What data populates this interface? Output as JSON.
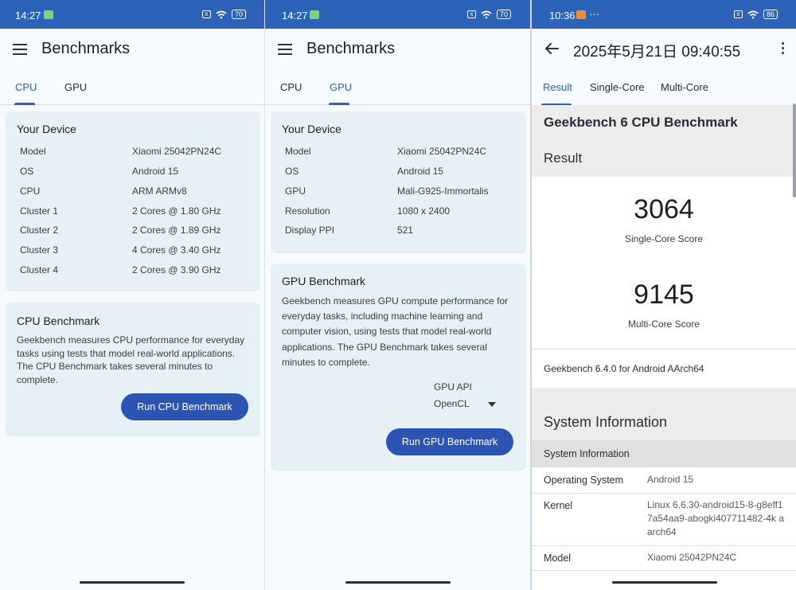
{
  "status": {
    "left_time": "14:27",
    "right_time": "10:36",
    "battery_left": "70",
    "battery_right": "86",
    "dots": "···",
    "x_box": "x"
  },
  "phone1": {
    "title": "Benchmarks",
    "tabs": [
      "CPU",
      "GPU"
    ],
    "device_card": {
      "title": "Your Device",
      "rows": [
        {
          "label": "Model",
          "value": "Xiaomi 25042PN24C"
        },
        {
          "label": "OS",
          "value": "Android 15"
        },
        {
          "label": "CPU",
          "value": "ARM ARMv8"
        },
        {
          "label": "Cluster 1",
          "value": "2 Cores @ 1.80 GHz"
        },
        {
          "label": "Cluster 2",
          "value": "2 Cores @ 1.89 GHz"
        },
        {
          "label": "Cluster 3",
          "value": "4 Cores @ 3.40 GHz"
        },
        {
          "label": "Cluster 4",
          "value": "2 Cores @ 3.90 GHz"
        }
      ]
    },
    "bench_card": {
      "title": "CPU Benchmark",
      "description": "Geekbench measures CPU performance for everyday tasks using tests that model real-world applications. The CPU Benchmark takes several minutes to complete.",
      "button": "Run CPU Benchmark"
    }
  },
  "phone2": {
    "title": "Benchmarks",
    "tabs": [
      "CPU",
      "GPU"
    ],
    "device_card": {
      "title": "Your Device",
      "rows": [
        {
          "label": "Model",
          "value": "Xiaomi 25042PN24C"
        },
        {
          "label": "OS",
          "value": "Android 15"
        },
        {
          "label": "GPU",
          "value": "Mali-G925-Immortalis"
        },
        {
          "label": "Resolution",
          "value": "1080 x 2400"
        },
        {
          "label": "Display PPI",
          "value": "521"
        }
      ]
    },
    "bench_card": {
      "title": "GPU Benchmark",
      "description": "Geekbench measures GPU compute performance for everyday tasks, including machine learning and computer vision, using tests that model real-world applications. The GPU Benchmark takes several minutes to complete.",
      "api_label": "GPU API",
      "api_value": "OpenCL",
      "button": "Run GPU Benchmark"
    }
  },
  "phone3": {
    "title": "2025年5月21日 09:40:55",
    "tabs": [
      "Result",
      "Single-Core",
      "Multi-Core"
    ],
    "heading": "Geekbench 6 CPU Benchmark",
    "result_label": "Result",
    "single_score": "3064",
    "single_label": "Single-Core Score",
    "multi_score": "9145",
    "multi_label": "Multi-Core Score",
    "version": "Geekbench 6.4.0 for Android AArch64",
    "sysinfo_heading": "System Information",
    "sysinfo_subheading": "System Information",
    "rows": [
      {
        "label": "Operating System",
        "value": "Android 15"
      },
      {
        "label": "Kernel",
        "value": "Linux 6.6.30-android15-8-g8eff17a54aa9-abogki407711482-4k aarch64"
      },
      {
        "label": "Model",
        "value": "Xiaomi 25042PN24C"
      }
    ]
  },
  "colors": {
    "status_bar": "#2c63b9",
    "accent": "#2c63b9",
    "button": "#2c55b3",
    "card": "#e6f1f5"
  }
}
